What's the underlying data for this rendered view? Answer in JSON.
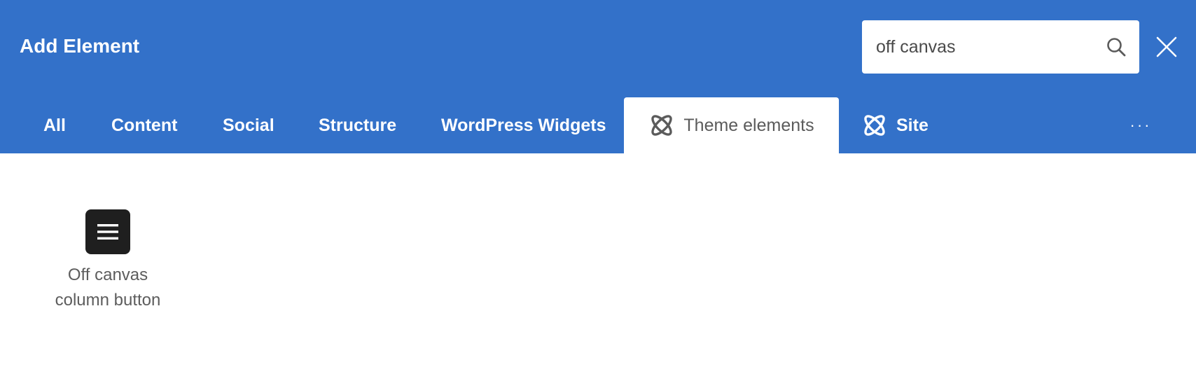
{
  "header": {
    "title": "Add Element",
    "background_color": "#3371c9"
  },
  "search": {
    "value": "off canvas",
    "icon": "search-icon"
  },
  "close": {
    "icon": "close-icon"
  },
  "tabs": [
    {
      "label": "All",
      "active": false
    },
    {
      "label": "Content",
      "active": false
    },
    {
      "label": "Social",
      "active": false
    },
    {
      "label": "Structure",
      "active": false
    },
    {
      "label": "WordPress Widgets",
      "active": false
    },
    {
      "label": "Theme elements",
      "active": true,
      "icon": "theme-elements-icon"
    },
    {
      "label": "Site",
      "active": false,
      "icon": "site-icon"
    }
  ],
  "more": {
    "label": "···",
    "icon": "more-icon"
  },
  "elements": [
    {
      "label_line1": "Off canvas",
      "label_line2": "column button",
      "icon": "hamburger-menu-icon"
    }
  ]
}
